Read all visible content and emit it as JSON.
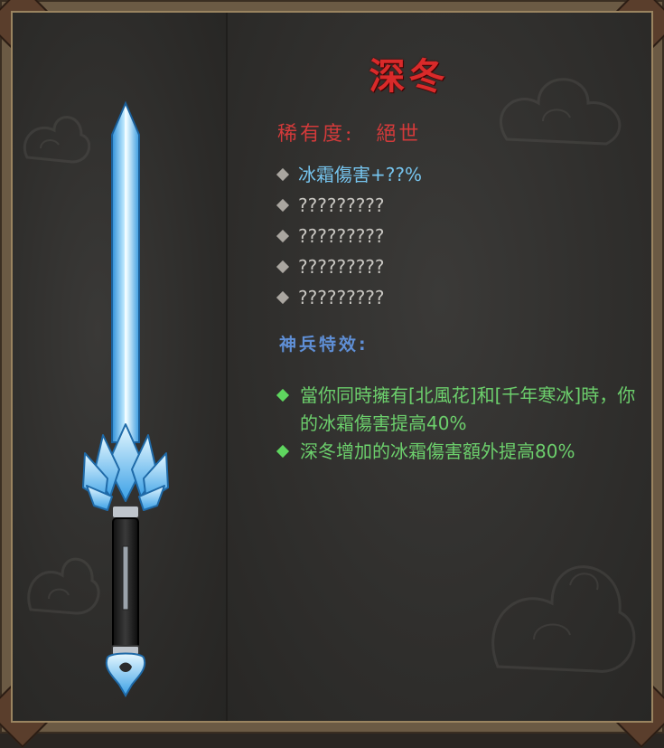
{
  "item": {
    "name": "深冬",
    "rarity_label": "稀有度:",
    "rarity_value": "絕世",
    "stats": [
      "冰霜傷害+??%",
      "?????????",
      "?????????",
      "?????????",
      "?????????"
    ],
    "special_effect_heading": "神兵特效:",
    "special_effects": [
      "當你同時擁有[北風花]和[千年寒冰]時，你的冰霜傷害提高40%",
      "深冬增加的冰霜傷害額外提高80%"
    ],
    "icon": "ice-sword-icon"
  },
  "colors": {
    "title": "#d92a2a",
    "rarity": "#d33a3a",
    "first_stat": "#76c4ee",
    "hidden_stat": "#c9c7c2",
    "effect_heading": "#5f8fd6",
    "effect_text": "#6ccf6c"
  }
}
